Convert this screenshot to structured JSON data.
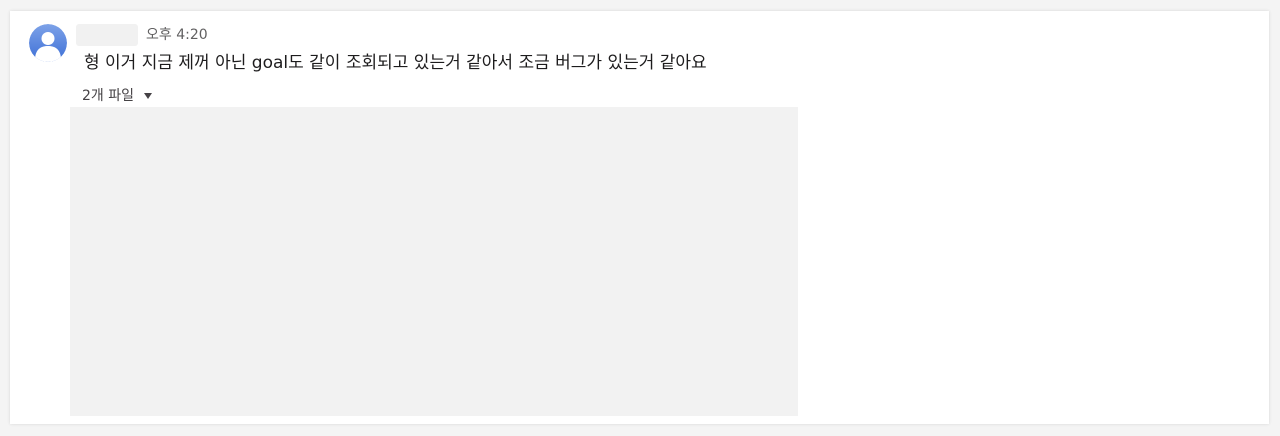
{
  "message": {
    "sender_name": "",
    "timestamp": "오후 4:20",
    "text": "형 이거 지금 제꺼 아닌 goal도 같이 조회되고 있는거 같아서 조금 버그가 있는거 같아요",
    "files": {
      "label": "2개 파일",
      "toggle_icon": "caret-down-icon"
    }
  },
  "avatar": {
    "icon": "user-avatar-icon",
    "colors": {
      "top": "#7da2e8",
      "bottom": "#3d6fd6",
      "figure": "#ffffff"
    }
  },
  "colors": {
    "text_primary": "#1d1c1d",
    "text_secondary": "#616061",
    "preview_background": "#f2f2f2"
  }
}
